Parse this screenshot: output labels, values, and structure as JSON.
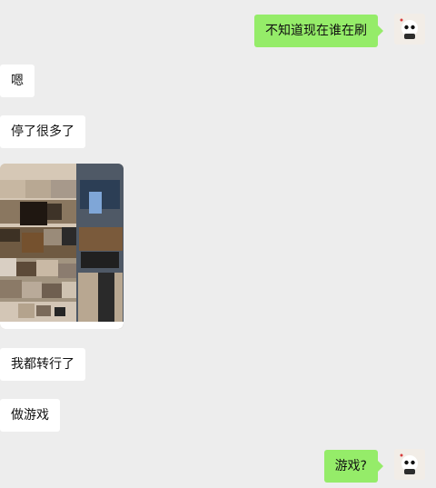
{
  "messages": [
    {
      "id": "m1",
      "side": "right",
      "text": "不知道现在谁在刷"
    },
    {
      "id": "m2",
      "side": "left",
      "text": "嗯"
    },
    {
      "id": "m3",
      "side": "left",
      "text": "停了很多了"
    },
    {
      "id": "m4",
      "side": "left",
      "type": "image",
      "image_icon": "photo-icon"
    },
    {
      "id": "m5",
      "side": "left",
      "text": "我都转行了"
    },
    {
      "id": "m6",
      "side": "left",
      "text": "做游戏"
    },
    {
      "id": "m7",
      "side": "right",
      "text": "游戏?"
    }
  ],
  "colors": {
    "background": "#ededed",
    "incoming_bubble": "#ffffff",
    "outgoing_bubble": "#95ec69"
  },
  "icons": {
    "avatar": "avatar-icon"
  }
}
